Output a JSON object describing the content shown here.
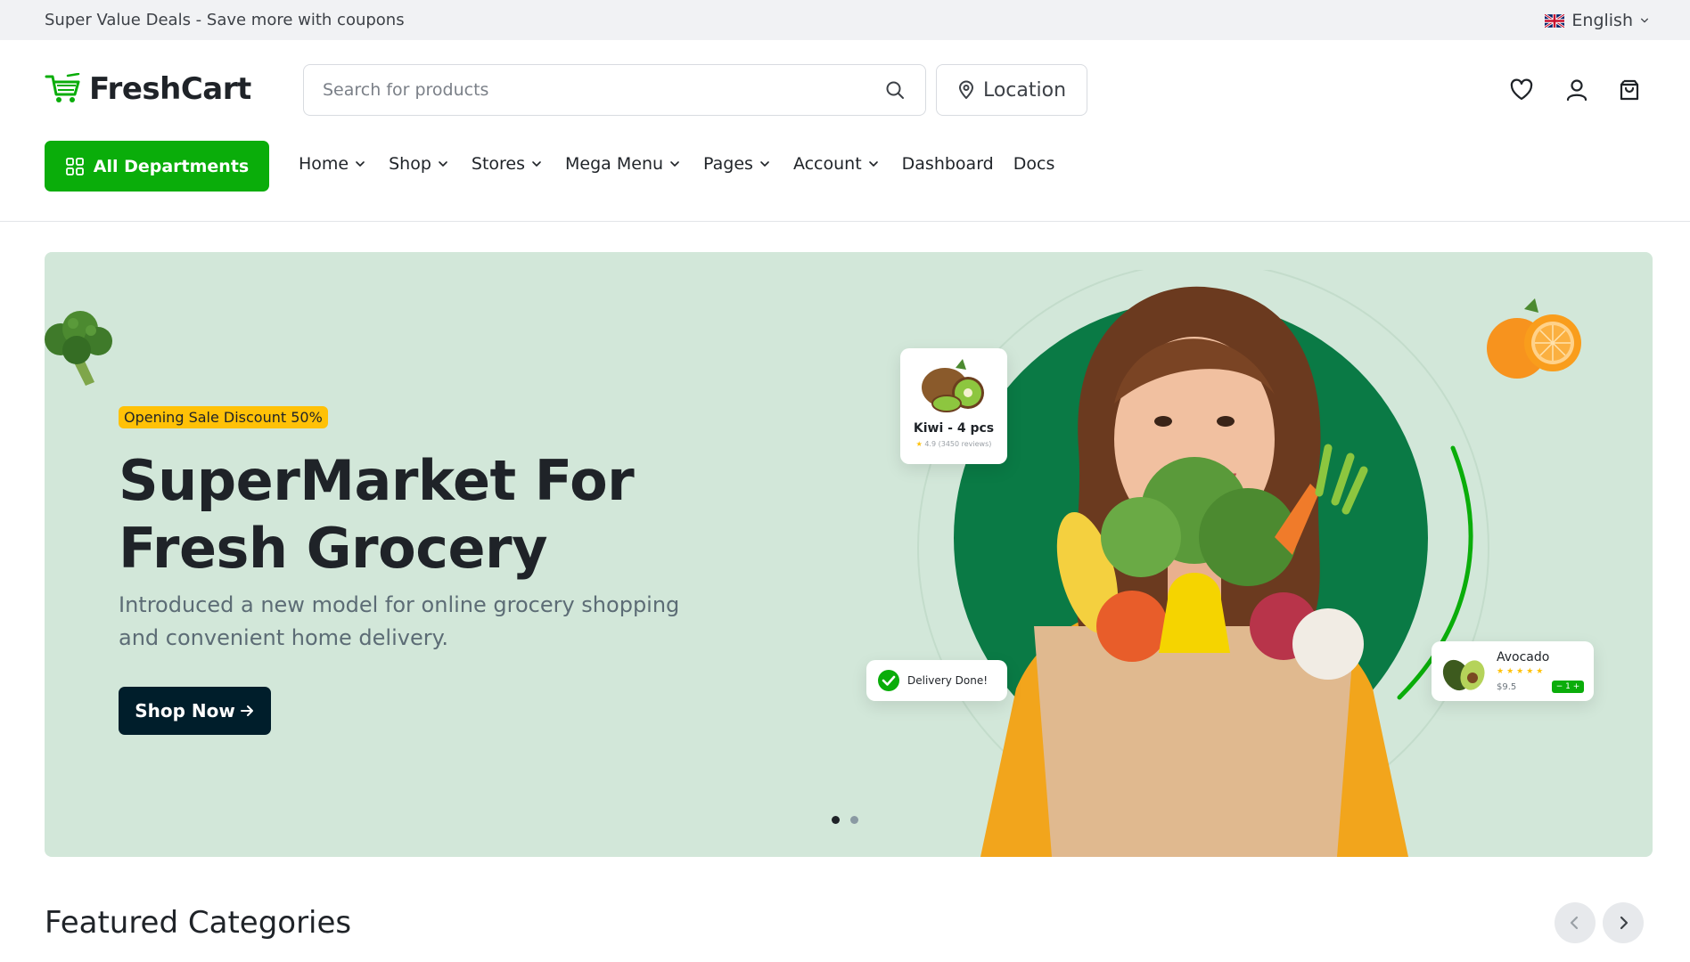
{
  "topbar": {
    "promo": "Super Value Deals - Save more with coupons",
    "language": "English"
  },
  "header": {
    "logo_text": "FreshCart",
    "search_placeholder": "Search for products",
    "location_label": "Location"
  },
  "nav": {
    "departments_label": "All Departments",
    "items": [
      {
        "label": "Home",
        "dropdown": true
      },
      {
        "label": "Shop",
        "dropdown": true
      },
      {
        "label": "Stores",
        "dropdown": true
      },
      {
        "label": "Mega Menu",
        "dropdown": true
      },
      {
        "label": "Pages",
        "dropdown": true
      },
      {
        "label": "Account",
        "dropdown": true
      },
      {
        "label": "Dashboard",
        "dropdown": false
      },
      {
        "label": "Docs",
        "dropdown": false
      }
    ]
  },
  "hero": {
    "badge": "Opening Sale Discount 50%",
    "title": "SuperMarket For Fresh Grocery",
    "subtitle": "Introduced a new model for online grocery shopping and convenient home delivery.",
    "cta": "Shop Now",
    "kiwi_card": {
      "name": "Kiwi - 4 pcs",
      "rating": "4.9",
      "reviews": "(3450 reviews)"
    },
    "delivery_card": {
      "text": "Delivery Done!"
    },
    "avocado_card": {
      "name": "Avocado",
      "stars": 5,
      "price": "$9.5",
      "stepper": "− 1 +"
    },
    "carousel_active_index": 0,
    "carousel_count": 2
  },
  "featured": {
    "title": "Featured Categories"
  },
  "colors": {
    "brand_green": "#0aad0a",
    "hero_bg": "#d2e7d9",
    "badge_yellow": "#ffc107",
    "dark_button": "#001e2b",
    "topbar_bg": "#f1f2f4"
  },
  "icons": [
    "cart-logo-icon",
    "search-icon",
    "location-pin-icon",
    "heart-icon",
    "user-icon",
    "shopping-bag-icon",
    "grid-icon",
    "chevron-down-icon",
    "arrow-right-icon",
    "chevron-left-icon",
    "chevron-right-icon",
    "check-icon",
    "uk-flag-icon"
  ]
}
